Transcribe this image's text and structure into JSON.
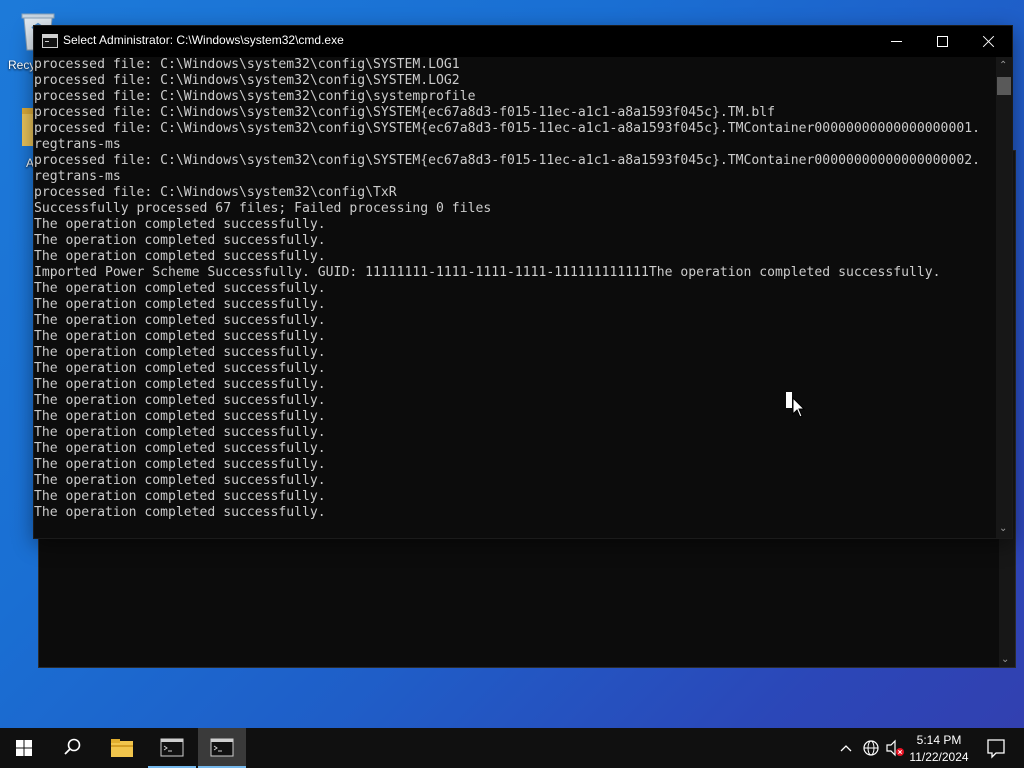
{
  "desktop": {
    "recycle_bin_label": "Recy",
    "second_icon_label": "A"
  },
  "window": {
    "title": "Select Administrator: C:\\Windows\\system32\\cmd.exe"
  },
  "console": {
    "lines": [
      "processed file: C:\\Windows\\system32\\config\\SYSTEM.LOG1",
      "processed file: C:\\Windows\\system32\\config\\SYSTEM.LOG2",
      "processed file: C:\\Windows\\system32\\config\\systemprofile",
      "processed file: C:\\Windows\\system32\\config\\SYSTEM{ec67a8d3-f015-11ec-a1c1-a8a1593f045c}.TM.blf",
      "processed file: C:\\Windows\\system32\\config\\SYSTEM{ec67a8d3-f015-11ec-a1c1-a8a1593f045c}.TMContainer00000000000000000001.",
      "regtrans-ms",
      "processed file: C:\\Windows\\system32\\config\\SYSTEM{ec67a8d3-f015-11ec-a1c1-a8a1593f045c}.TMContainer00000000000000000002.",
      "regtrans-ms",
      "processed file: C:\\Windows\\system32\\config\\TxR",
      "Successfully processed 67 files; Failed processing 0 files",
      "The operation completed successfully.",
      "The operation completed successfully.",
      "The operation completed successfully.",
      "Imported Power Scheme Successfully. GUID: 11111111-1111-1111-1111-111111111111The operation completed successfully.",
      "The operation completed successfully.",
      "The operation completed successfully.",
      "The operation completed successfully.",
      "The operation completed successfully.",
      "The operation completed successfully.",
      "The operation completed successfully.",
      "The operation completed successfully.",
      "The operation completed successfully.",
      "The operation completed successfully.",
      "The operation completed successfully.",
      "The operation completed successfully.",
      "The operation completed successfully.",
      "The operation completed successfully.",
      "The operation completed successfully.",
      "The operation completed successfully."
    ]
  },
  "taskbar": {
    "clock_time": "5:14 PM",
    "clock_date": "11/22/2024"
  },
  "colors": {
    "console_bg": "#0c0c0c",
    "console_fg": "#cccccc",
    "taskbar_bg": "#101010",
    "accent": "#76b9ed"
  },
  "icons": [
    "recycle-bin-icon",
    "folder-icon",
    "cmd-icon",
    "minimize-icon",
    "maximize-icon",
    "close-icon",
    "windows-logo-icon",
    "search-icon",
    "file-explorer-icon",
    "chevron-up-icon",
    "network-icon",
    "volume-muted-icon",
    "notification-icon",
    "mouse-cursor-icon"
  ]
}
